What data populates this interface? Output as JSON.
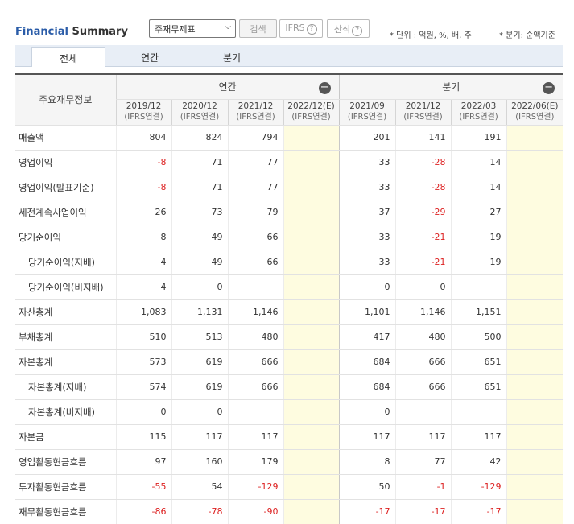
{
  "header": {
    "title_part1": "Financial",
    "title_part2": "Summary",
    "select_value": "주재무제표",
    "search_label": "검색",
    "ifrs_label": "IFRS",
    "calc_label": "산식",
    "help_glyph": "?",
    "unit_note": "* 단위 : 억원, %, 배, 주",
    "quarter_note": "* 분기: 순액기준"
  },
  "tabs": [
    "전체",
    "연간",
    "분기"
  ],
  "table": {
    "row_header": "주요재무정보",
    "groups": [
      {
        "label": "연간",
        "collapse_glyph": "−"
      },
      {
        "label": "분기",
        "collapse_glyph": "−"
      }
    ],
    "periods": [
      {
        "date": "2019/12",
        "basis": "(IFRS연결)"
      },
      {
        "date": "2020/12",
        "basis": "(IFRS연결)"
      },
      {
        "date": "2021/12",
        "basis": "(IFRS연결)"
      },
      {
        "date": "2022/12(E)",
        "basis": "(IFRS연결)"
      },
      {
        "date": "2021/09",
        "basis": "(IFRS연결)"
      },
      {
        "date": "2021/12",
        "basis": "(IFRS연결)"
      },
      {
        "date": "2022/03",
        "basis": "(IFRS연결)"
      },
      {
        "date": "2022/06(E)",
        "basis": "(IFRS연결)"
      }
    ],
    "rows": [
      {
        "label": "매출액",
        "indent": false,
        "values": [
          "804",
          "824",
          "794",
          "",
          "201",
          "141",
          "191",
          ""
        ]
      },
      {
        "label": "영업이익",
        "indent": false,
        "values": [
          "-8",
          "71",
          "77",
          "",
          "33",
          "-28",
          "14",
          ""
        ]
      },
      {
        "label": "영업이익(발표기준)",
        "indent": false,
        "values": [
          "-8",
          "71",
          "77",
          "",
          "33",
          "-28",
          "14",
          ""
        ]
      },
      {
        "label": "세전계속사업이익",
        "indent": false,
        "values": [
          "26",
          "73",
          "79",
          "",
          "37",
          "-29",
          "27",
          ""
        ]
      },
      {
        "label": "당기순이익",
        "indent": false,
        "values": [
          "8",
          "49",
          "66",
          "",
          "33",
          "-21",
          "19",
          ""
        ]
      },
      {
        "label": "당기순이익(지배)",
        "indent": true,
        "values": [
          "4",
          "49",
          "66",
          "",
          "33",
          "-21",
          "19",
          ""
        ]
      },
      {
        "label": "당기순이익(비지배)",
        "indent": true,
        "values": [
          "4",
          "0",
          "",
          "",
          "0",
          "0",
          "",
          ""
        ]
      },
      {
        "label": "자산총계",
        "indent": false,
        "values": [
          "1,083",
          "1,131",
          "1,146",
          "",
          "1,101",
          "1,146",
          "1,151",
          ""
        ]
      },
      {
        "label": "부채총계",
        "indent": false,
        "values": [
          "510",
          "513",
          "480",
          "",
          "417",
          "480",
          "500",
          ""
        ]
      },
      {
        "label": "자본총계",
        "indent": false,
        "values": [
          "573",
          "619",
          "666",
          "",
          "684",
          "666",
          "651",
          ""
        ]
      },
      {
        "label": "자본총계(지배)",
        "indent": true,
        "values": [
          "574",
          "619",
          "666",
          "",
          "684",
          "666",
          "651",
          ""
        ]
      },
      {
        "label": "자본총계(비지배)",
        "indent": true,
        "values": [
          "0",
          "0",
          "",
          "",
          "0",
          "",
          "",
          ""
        ]
      },
      {
        "label": "자본금",
        "indent": false,
        "values": [
          "115",
          "117",
          "117",
          "",
          "117",
          "117",
          "117",
          ""
        ]
      },
      {
        "label": "영업활동현금흐름",
        "indent": false,
        "values": [
          "97",
          "160",
          "179",
          "",
          "8",
          "77",
          "42",
          ""
        ]
      },
      {
        "label": "투자활동현금흐름",
        "indent": false,
        "values": [
          "-55",
          "54",
          "-129",
          "",
          "50",
          "-1",
          "-129",
          ""
        ]
      },
      {
        "label": "재무활동현금흐름",
        "indent": false,
        "values": [
          "-86",
          "-78",
          "-90",
          "",
          "-17",
          "-17",
          "-17",
          ""
        ]
      }
    ],
    "colors": {
      "negative": "#dd2222",
      "estimate_bg": "#fefce0",
      "title_blue": "#2a5ca8"
    }
  }
}
